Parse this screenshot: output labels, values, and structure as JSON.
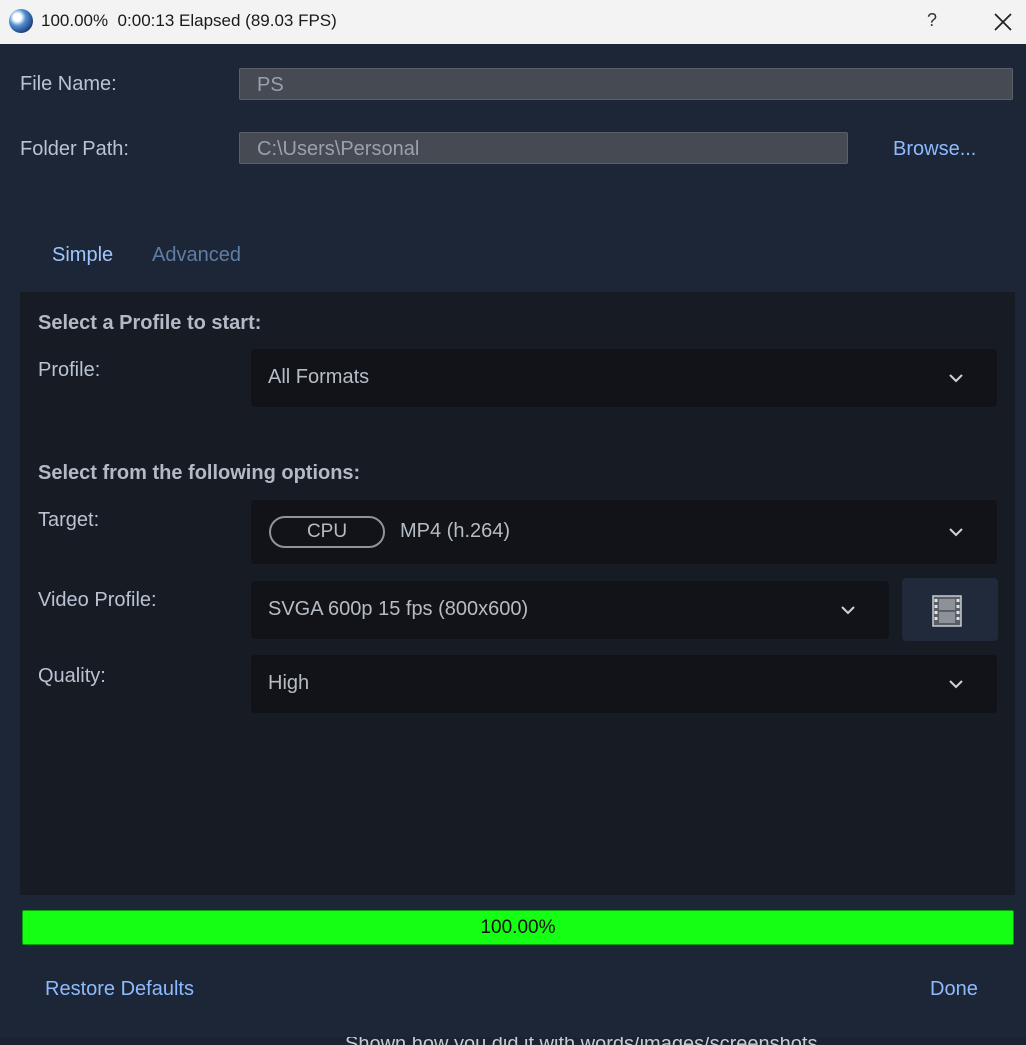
{
  "window": {
    "title": "100.00%  0:00:13 Elapsed (89.03 FPS)",
    "help": "?",
    "close_icon": "close-icon"
  },
  "file": {
    "name_label": "File Name:",
    "name_value": "PS",
    "folder_label": "Folder Path:",
    "folder_value": "C:\\Users\\Personal",
    "browse_label": "Browse..."
  },
  "tabs": [
    {
      "label": "Simple",
      "active": true
    },
    {
      "label": "Advanced",
      "active": false
    }
  ],
  "profile_section": {
    "heading": "Select a Profile to start:",
    "profile_label": "Profile:",
    "profile_value": "All Formats"
  },
  "options_section": {
    "heading": "Select from the following options:",
    "target_label": "Target:",
    "target_badge": "CPU",
    "target_value": "MP4 (h.264)",
    "video_profile_label": "Video Profile:",
    "video_profile_value": "SVGA 600p 15 fps (800x600)",
    "quality_label": "Quality:",
    "quality_value": "High"
  },
  "progress": {
    "value": 1.0,
    "text": "100.00%",
    "color": "#14ff14"
  },
  "footer": {
    "restore_label": "Restore Defaults",
    "done_label": "Done"
  },
  "background_text": "Shown how you did it with words/images/screenshots"
}
